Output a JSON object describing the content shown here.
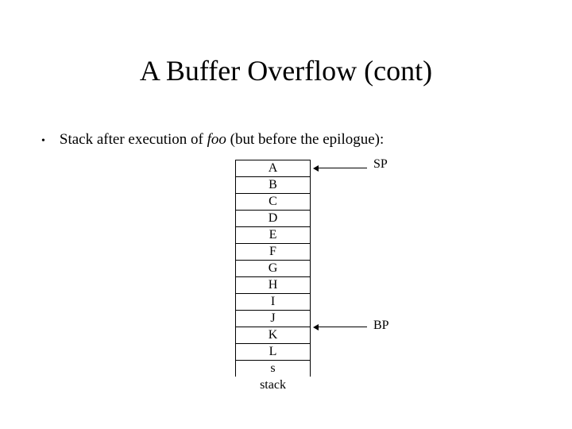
{
  "title": "A Buffer Overflow (cont)",
  "bullet": {
    "prefix": "Stack after execution of ",
    "italic": "foo",
    "suffix": " (but before the epilogue):"
  },
  "stack": {
    "cells": [
      "A",
      "B",
      "C",
      "D",
      "E",
      "F",
      "G",
      "H",
      "I",
      "J",
      "K",
      "L",
      "s"
    ],
    "label": "stack"
  },
  "pointers": {
    "sp": "SP",
    "bp": "BP"
  }
}
